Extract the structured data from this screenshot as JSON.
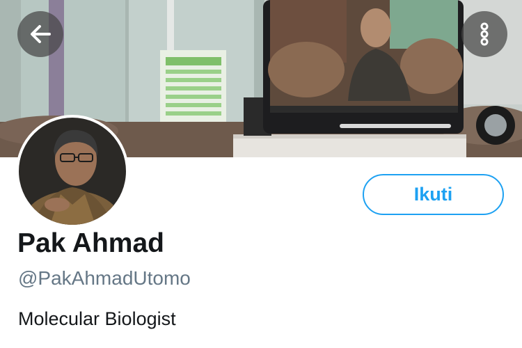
{
  "header": {
    "back_icon": "arrow-left-icon",
    "more_icon": "more-vertical-icon"
  },
  "profile": {
    "name": "Pak Ahmad",
    "handle": "@PakAhmadUtomo",
    "bio": "Molecular Biologist",
    "follow_label": "Ikuti"
  },
  "colors": {
    "accent": "#1da1f2",
    "name_text": "#14171a",
    "handle_text": "#657786"
  }
}
